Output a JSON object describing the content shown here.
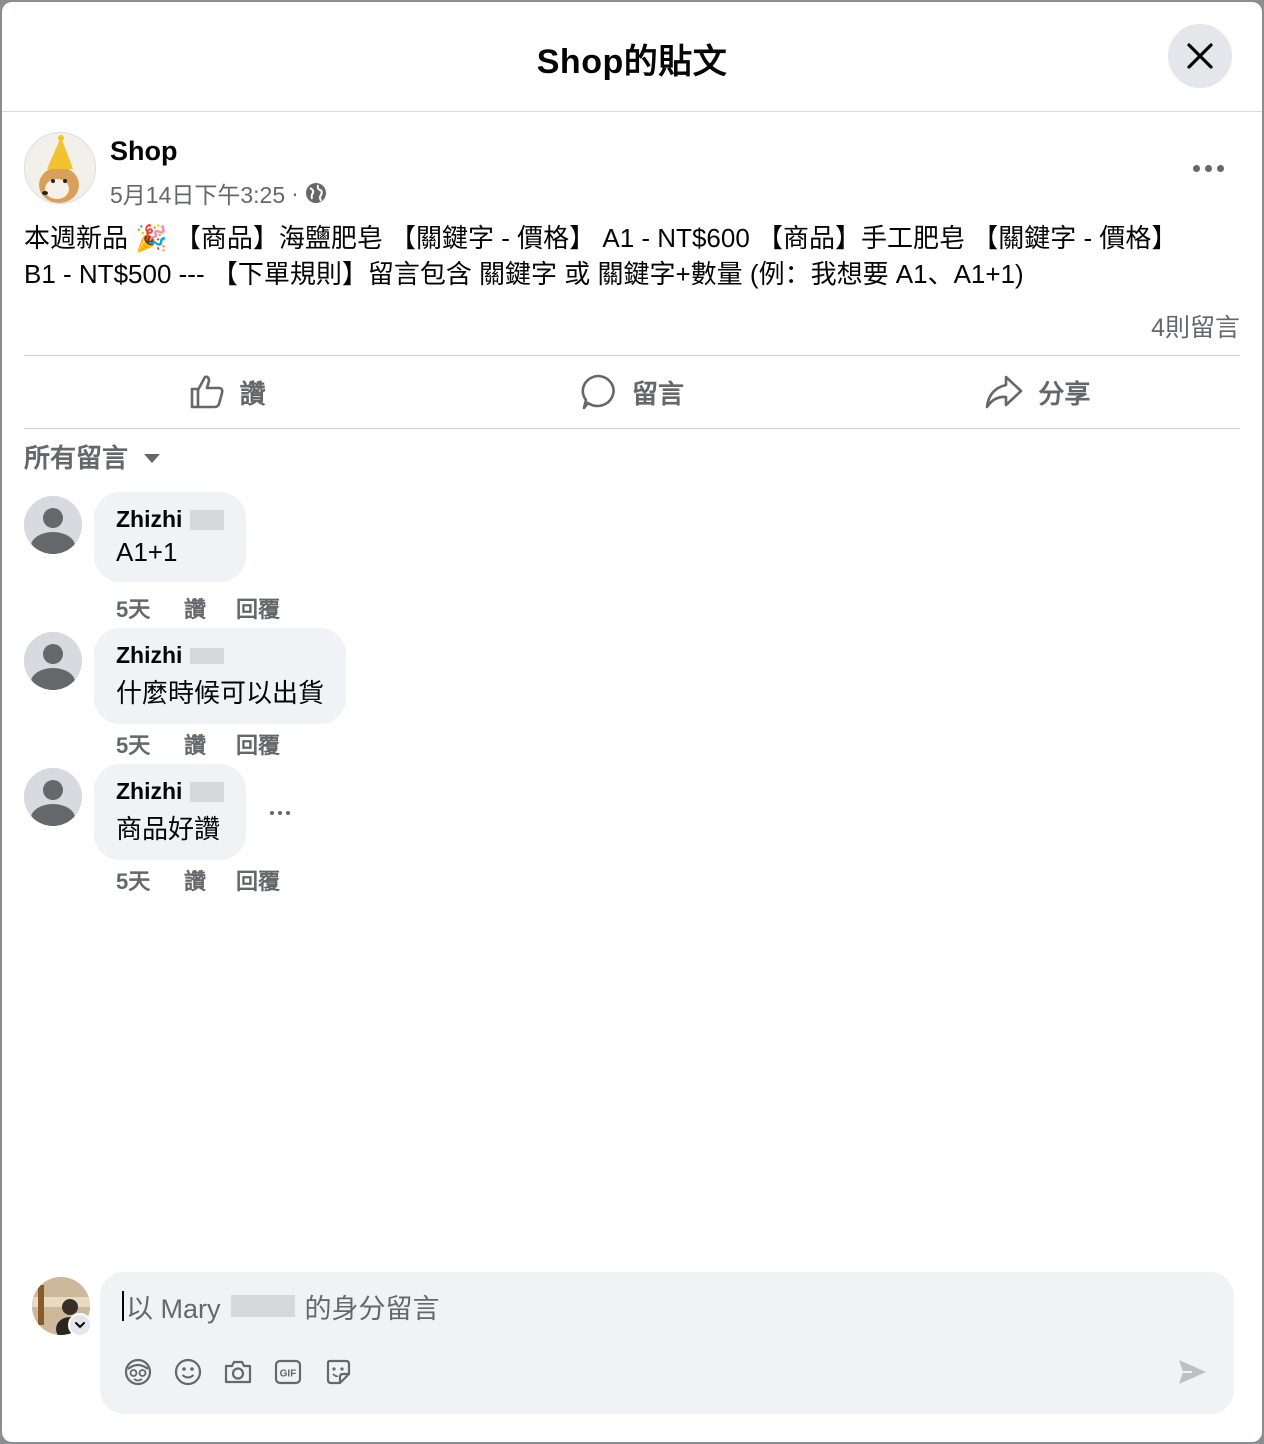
{
  "dialog": {
    "title": "Shop的貼文",
    "close_icon": "close-icon"
  },
  "post": {
    "author": "Shop",
    "timestamp": "5月14日下午3:25",
    "separator": "·",
    "privacy_icon": "globe-icon",
    "text_line1": "本週新品 🎉 【商品】海鹽肥皂 【關鍵字 - 價格】 A1 - NT$600 【商品】手工肥皂 【關鍵字 - 價格】",
    "text_line2": "B1 - NT$500 --- 【下單規則】留言包含 關鍵字 或 關鍵字+數量 (例：我想要 A1、A1+1)",
    "comment_count": "4則留言",
    "actions": {
      "like": "讚",
      "comment": "留言",
      "share": "分享"
    }
  },
  "filter": {
    "label": "所有留言"
  },
  "comments": [
    {
      "name": "Zhizhi",
      "text": "A1+1",
      "time": "5天",
      "like": "讚",
      "reply": "回覆"
    },
    {
      "name": "Zhizhi",
      "text": "什麼時候可以出貨",
      "time": "5天",
      "like": "讚",
      "reply": "回覆"
    },
    {
      "name": "Zhizhi",
      "text": "商品好讚",
      "time": "5天",
      "like": "讚",
      "reply": "回覆"
    }
  ],
  "composer": {
    "placeholder_prefix": "以 Mary",
    "placeholder_suffix": "的身分留言",
    "tools": [
      "avatar-sticker-icon",
      "emoji-icon",
      "camera-icon",
      "gif-icon",
      "sticker-icon"
    ],
    "send_icon": "send-icon"
  }
}
